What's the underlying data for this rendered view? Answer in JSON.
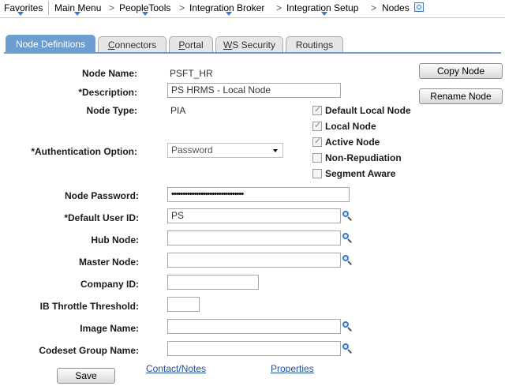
{
  "menubar": {
    "favorites": "Favorites",
    "main_menu": "Main Menu",
    "crumbs": [
      "PeopleTools",
      "Integration Broker",
      "Integration Setup",
      "Nodes"
    ],
    "sep": ">"
  },
  "tabs": [
    {
      "label": "Node Definitions",
      "active": true
    },
    {
      "label": "Connectors",
      "underline_char": "C",
      "rest": "onnectors"
    },
    {
      "label": "Portal",
      "underline_char": "P",
      "rest": "ortal"
    },
    {
      "label": "WS Security",
      "underline_char": "W",
      "rest": "S Security"
    },
    {
      "label": "Routings"
    }
  ],
  "form": {
    "node_name_label": "Node Name:",
    "node_name": "PSFT_HR",
    "description_label": "*Description:",
    "description": "PS HRMS - Local Node",
    "node_type_label": "Node Type:",
    "node_type": "PIA",
    "auth_label": "*Authentication Option:",
    "auth_value": "Password",
    "node_password_label": "Node Password:",
    "node_password": "••••••••••••••••••••••••••••••••",
    "default_user_label": "*Default User ID:",
    "default_user": "PS",
    "hub_node_label": "Hub Node:",
    "hub_node": "",
    "master_node_label": "Master Node:",
    "master_node": "",
    "company_id_label": "Company ID:",
    "company_id": "",
    "ib_throttle_label": "IB Throttle Threshold:",
    "ib_throttle": "",
    "image_name_label": "Image Name:",
    "image_name": "",
    "codeset_label": "Codeset Group Name:",
    "codeset": ""
  },
  "checkboxes": [
    {
      "label": "Default Local Node",
      "checked": true
    },
    {
      "label": "Local Node",
      "checked": true
    },
    {
      "label": "Active Node",
      "checked": true
    },
    {
      "label": "Non-Repudiation",
      "checked": false
    },
    {
      "label": "Segment Aware",
      "checked": false
    }
  ],
  "buttons": {
    "copy_node": "Copy Node",
    "rename_node": "Rename Node",
    "save": "Save"
  },
  "links": {
    "contact_notes": "Contact/Notes",
    "properties": "Properties"
  },
  "icons": {
    "lookup": "search-icon",
    "dropdown": "chevron-down-icon",
    "menu_arrow": "chevron-down-icon",
    "nav_search": "search-icon"
  },
  "colors": {
    "tab_active": "#6d9ecf",
    "link": "#1f4f9c",
    "icon_blue": "#3a7bc8"
  }
}
